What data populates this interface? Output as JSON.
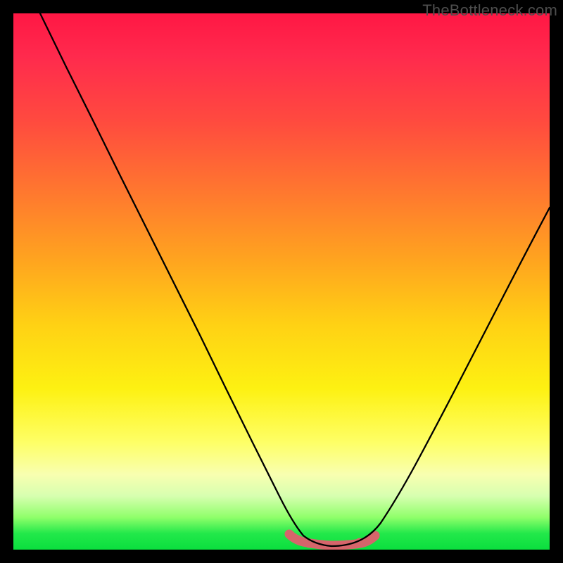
{
  "watermark_text": "TheBottleneck.com",
  "chart_data": {
    "type": "line",
    "title": "",
    "xlabel": "",
    "ylabel": "",
    "xlim": [
      0,
      100
    ],
    "ylim": [
      0,
      100
    ],
    "grid": false,
    "legend": false,
    "series": [
      {
        "name": "bottleneck-curve",
        "x": [
          5,
          10,
          15,
          20,
          25,
          30,
          35,
          40,
          45,
          50,
          52,
          54,
          56,
          58,
          60,
          62,
          64,
          68,
          72,
          76,
          80,
          84,
          88,
          92,
          96,
          100
        ],
        "y": [
          100,
          90,
          80,
          70,
          60,
          50,
          40,
          30,
          20,
          10,
          6,
          3,
          1,
          0,
          0,
          0,
          1,
          4,
          9,
          15,
          22,
          30,
          38,
          46,
          55,
          64
        ]
      },
      {
        "name": "fit-band",
        "x": [
          52,
          54,
          56,
          58,
          60,
          62,
          64,
          66
        ],
        "y": [
          3,
          1.5,
          0.8,
          0.5,
          0.5,
          0.8,
          1.5,
          3
        ]
      }
    ],
    "colors": {
      "curve": "#000000",
      "fit_band": "#d6656b"
    }
  }
}
